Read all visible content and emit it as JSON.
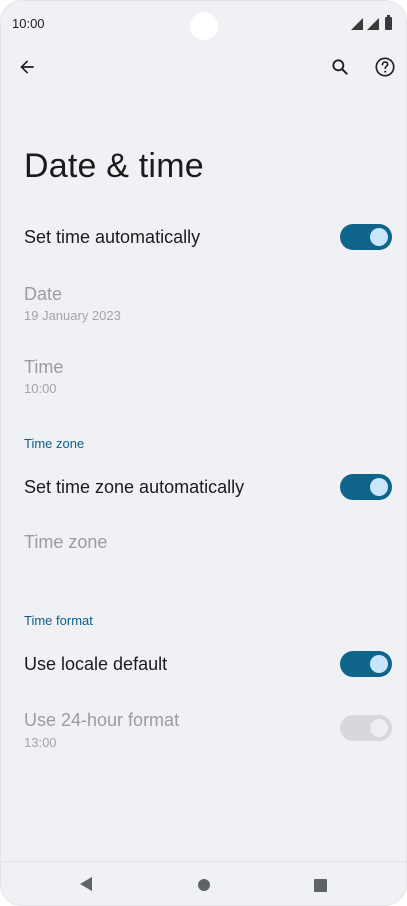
{
  "status_bar": {
    "time": "10:00"
  },
  "toolbar": {
    "back_icon": "arrow-back-icon",
    "search_icon": "search-icon",
    "help_icon": "help-icon"
  },
  "page": {
    "title": "Date & time"
  },
  "settings": {
    "auto_time": {
      "label": "Set time automatically",
      "enabled": true
    },
    "date": {
      "label": "Date",
      "value": "19 January 2023"
    },
    "time": {
      "label": "Time",
      "value": "10:00"
    },
    "time_zone_section": "Time zone",
    "auto_time_zone": {
      "label": "Set time zone automatically",
      "enabled": true
    },
    "time_zone": {
      "label": "Time zone"
    },
    "time_format_section": "Time format",
    "locale_default": {
      "label": "Use locale default",
      "enabled": true
    },
    "hour_24": {
      "label": "Use 24-hour format",
      "value": "13:00",
      "enabled": true
    }
  },
  "colors": {
    "accent": "#0f6489",
    "section_header": "#0d5e86",
    "background": "#eff1f4"
  }
}
